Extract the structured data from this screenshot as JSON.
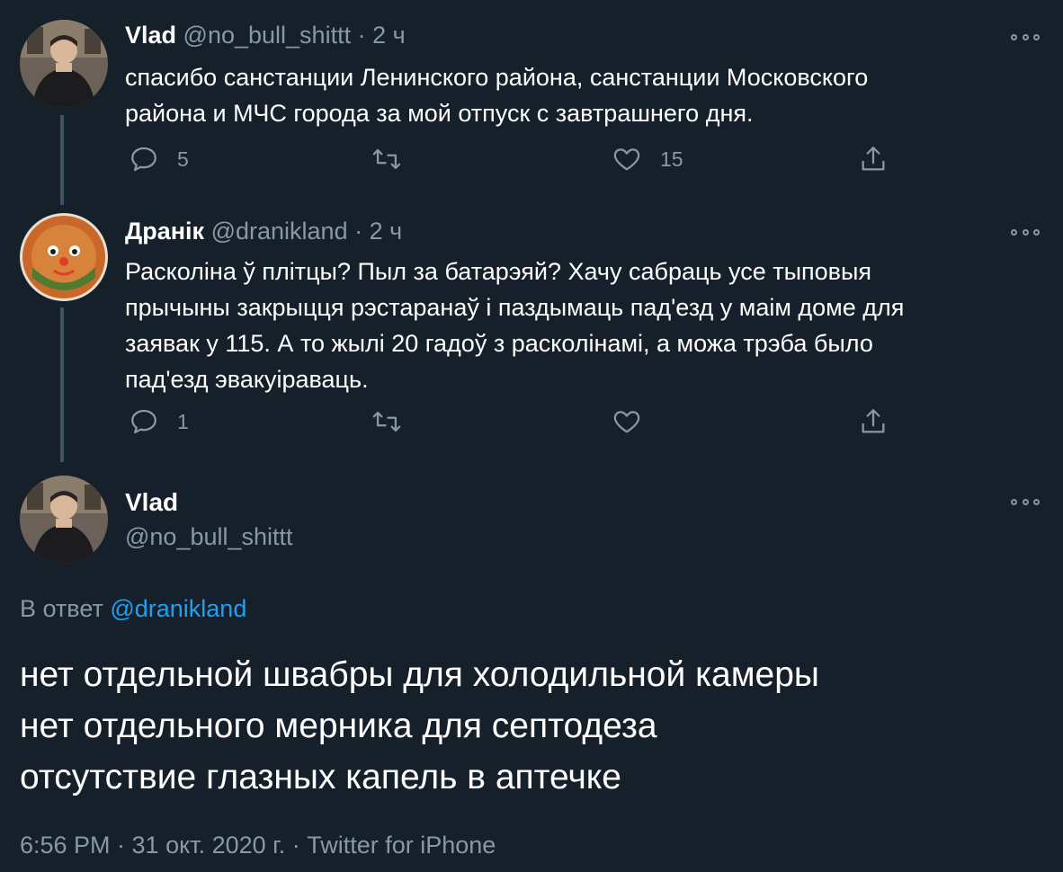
{
  "tweets": [
    {
      "name": "Vlad",
      "handle": "@no_bull_shittt",
      "separator": "·",
      "time": "2 ч",
      "text_lines": [
        "спасибо санстанции Ленинского района, санстанции Московского",
        "района и МЧС города за мой отпуск с завтрашнего дня."
      ],
      "reply_count": "5",
      "retweet_count": "",
      "like_count": "15"
    },
    {
      "name": "Дранік",
      "handle": "@dranikland",
      "separator": "·",
      "time": "2 ч",
      "text_lines": [
        "Расколіна ў плітцы? Пыл за батарэяй? Хачу сабраць усе тыповыя",
        "прычыны закрыцця рэстаранаў і паздымаць пад'езд у маім доме для",
        "заявак у 115. А то жылі 20 гадоў з расколінамі, а можа трэба было",
        "пад'езд эвакуіраваць."
      ],
      "reply_count": "1",
      "retweet_count": "",
      "like_count": ""
    }
  ],
  "main_tweet": {
    "name": "Vlad",
    "handle": "@no_bull_shittt",
    "reply_prefix": "В ответ",
    "reply_mention": "@dranikland",
    "text_lines": [
      "нет отдельной швабры для холодильной камеры",
      "нет отдельного мерника для септодеза",
      "отсутствие глазных капель в аптечке"
    ],
    "footer": "6:56 PM · 31 окт. 2020 г. · Twitter for iPhone"
  },
  "icons": {
    "reply": "reply-icon",
    "retweet": "retweet-icon",
    "like": "heart-icon",
    "share": "share-icon",
    "more": "more-icon"
  },
  "colors": {
    "background": "#15202b",
    "secondary_text": "#8899a6",
    "link": "#1da1f2",
    "thread_line": "#3d5466"
  }
}
